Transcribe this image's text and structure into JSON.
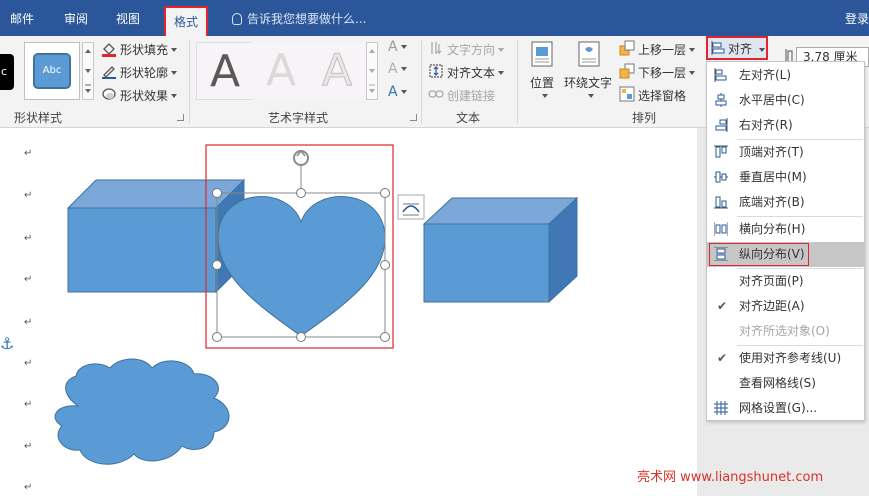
{
  "tabs": [
    {
      "label": "邮件"
    },
    {
      "label": "审阅"
    },
    {
      "label": "视图"
    },
    {
      "label": "格式",
      "active": true
    }
  ],
  "tell_me_placeholder": "告诉我您想要做什么...",
  "login_label": "登录",
  "ribbon": {
    "shape_styles": {
      "sample_left": "c",
      "sample_label": "Abc",
      "fill_label": "形状填充",
      "outline_label": "形状轮廓",
      "effect_label": "形状效果",
      "group_label": "形状样式"
    },
    "wordart": {
      "letters": [
        "A",
        "A",
        "A"
      ],
      "side_letters": [
        "A",
        "A",
        "A"
      ],
      "group_label": "艺术字样式"
    },
    "text": {
      "direction_label": "文字方向",
      "align_label": "对齐文本",
      "link_label": "创建链接",
      "group_label": "文本"
    },
    "arrange": {
      "position_label": "位置",
      "wrap_label": "环绕文字",
      "forward_label": "上移一层",
      "backward_label": "下移一层",
      "pane_label": "选择窗格",
      "group_label": "排列"
    },
    "align_button_label": "对齐",
    "size_value": "3.78 厘米"
  },
  "align_menu": {
    "items": [
      {
        "label": "左对齐(L)",
        "icon": "align-left-icon"
      },
      {
        "label": "水平居中(C)",
        "icon": "align-center-icon"
      },
      {
        "label": "右对齐(R)",
        "icon": "align-right-icon"
      },
      {
        "label": "顶端对齐(T)",
        "icon": "align-top-icon"
      },
      {
        "label": "垂直居中(M)",
        "icon": "align-middle-icon"
      },
      {
        "label": "底端对齐(B)",
        "icon": "align-bottom-icon"
      },
      {
        "label": "横向分布(H)",
        "icon": "distribute-horizontal-icon"
      },
      {
        "label": "纵向分布(V)",
        "icon": "distribute-vertical-icon",
        "highlighted": true
      },
      {
        "label": "对齐页面(P)"
      },
      {
        "label": "对齐边距(A)",
        "checked": true
      },
      {
        "label": "对齐所选对象(O)",
        "disabled": true
      },
      {
        "label": "使用对齐参考线(U)",
        "checked": true
      },
      {
        "label": "查看网格线(S)"
      },
      {
        "label": "网格设置(G)...",
        "icon": "grid-icon"
      }
    ]
  },
  "paragraph_mark": "↵",
  "colors": {
    "title_bar": "#2b579a",
    "shape_fill": "#5b9bd5",
    "highlight_border": "#e0262a"
  },
  "watermark": "亮术网 www.liangshunet.com"
}
